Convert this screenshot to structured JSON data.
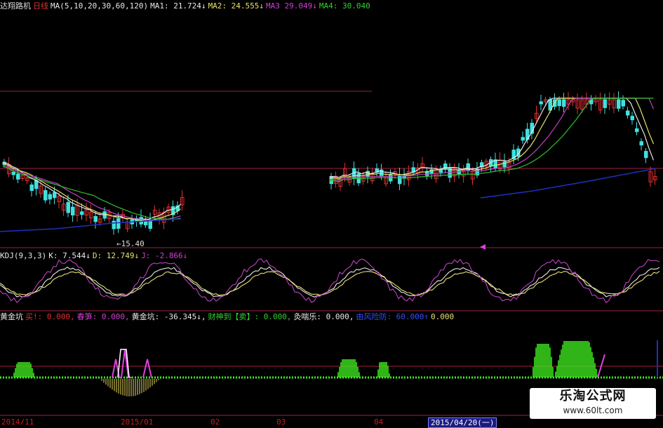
{
  "main_panel": {
    "title": "达翔路机",
    "period": "日线",
    "ma_params": "MA(5,10,20,30,60,120)",
    "ma1": "MA1: 21.724↓",
    "ma2": "MA2: 24.555↓",
    "ma3": "MA3  29.049↓",
    "ma4": "MA4: 30.040",
    "low_marker": "←15.40"
  },
  "kdj_panel": {
    "params": "KDJ(9,3,3)",
    "k": "K: 7.544↓",
    "d": "D: 12.749↓",
    "j": "J: -2.866↓"
  },
  "indicator_panel": {
    "name": "黄金坑",
    "buy": "买!: 0.000,",
    "spring": "春笋: 0.000,",
    "golden_pit": "黄金坑: -36.345↓,",
    "caishen": "财神到【卖】: 0.000,",
    "yanxile": "灸喘乐: 0.000,",
    "fengkong": "由风险防: 60.000↑",
    "last": "0.000"
  },
  "time_axis": [
    "2014/11",
    "2015/01",
    "02",
    "03",
    "04"
  ],
  "cursor_date": "2015/04/20(一)",
  "watermark": {
    "name": "乐淘公式网",
    "url": "www.60lt.com"
  },
  "colors": {
    "background": "#000000",
    "candle_up": "#e03030",
    "candle_down": "#40e0e0",
    "ma_white": "#e8e8e8",
    "ma_yellow": "#e8e070",
    "ma_magenta": "#c040c0",
    "ma_green": "#30c030",
    "ma_blue": "#2030c0",
    "separator": "#a02040",
    "indicator_green": "#40f020",
    "indicator_magenta": "#e040e0",
    "indicator_yellow": "#f0e060"
  }
}
